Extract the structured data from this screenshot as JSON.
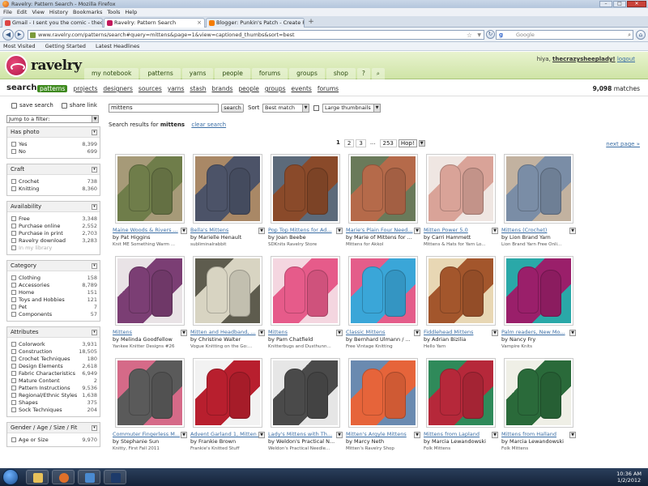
{
  "browser": {
    "window_title": "Ravelry: Pattern Search - Mozilla Firefox",
    "menu": [
      "File",
      "Edit",
      "View",
      "History",
      "Bookmarks",
      "Tools",
      "Help"
    ],
    "tabs": [
      {
        "label": "Gmail - I sent you the comic - thecraz...",
        "active": false
      },
      {
        "label": "Ravelry: Pattern Search",
        "active": true
      },
      {
        "label": "Blogger: Punkin's Patch - Create Post",
        "active": false
      }
    ],
    "url": "www.ravelry.com/patterns/search#query=mittens&page=1&view=captioned_thumbs&sort=best",
    "search_placeholder": "Google",
    "bookmarks": [
      "Most Visited",
      "Getting Started",
      "Latest Headlines"
    ]
  },
  "site": {
    "logo_text": "ravelry",
    "nav": [
      "my notebook",
      "patterns",
      "yarns",
      "people",
      "forums",
      "groups",
      "shop"
    ],
    "greeting": "hiya,",
    "username": "thecrazysheeplady!",
    "logout": "logout"
  },
  "subnav": {
    "title": "search",
    "links": [
      "patterns",
      "projects",
      "designers",
      "sources",
      "yarns",
      "stash",
      "brands",
      "people",
      "groups",
      "events",
      "forums"
    ],
    "selected": "patterns",
    "matches_count": "9,098",
    "matches_label": "matches"
  },
  "sidebar": {
    "save_search": "save search",
    "share_link": "share link",
    "jump_to_filter": "Jump to a filter:",
    "filters": [
      {
        "title": "Has photo",
        "rows": [
          {
            "label": "Yes",
            "count": "8,399"
          },
          {
            "label": "No",
            "count": "699"
          }
        ]
      },
      {
        "title": "Craft",
        "rows": [
          {
            "label": "Crochet",
            "count": "738"
          },
          {
            "label": "Knitting",
            "count": "8,360"
          }
        ]
      },
      {
        "title": "Availability",
        "rows": [
          {
            "label": "Free",
            "count": "3,348"
          },
          {
            "label": "Purchase online",
            "count": "2,552"
          },
          {
            "label": "Purchase in print",
            "count": "2,703"
          },
          {
            "label": "Ravelry download",
            "count": "3,283"
          },
          {
            "label": "In my library",
            "count": "",
            "dim": true
          }
        ]
      },
      {
        "title": "Category",
        "rows": [
          {
            "label": "Clothing",
            "count": "158"
          },
          {
            "label": "Accessories",
            "count": "8,789"
          },
          {
            "label": "Home",
            "count": "151"
          },
          {
            "label": "Toys and Hobbies",
            "count": "121"
          },
          {
            "label": "Pet",
            "count": "7"
          },
          {
            "label": "Components",
            "count": "57"
          }
        ]
      },
      {
        "title": "Attributes",
        "rows": [
          {
            "label": "Colorwork",
            "count": "3,931"
          },
          {
            "label": "Construction",
            "count": "18,505"
          },
          {
            "label": "Crochet Techniques",
            "count": "180"
          },
          {
            "label": "Design Elements",
            "count": "2,618"
          },
          {
            "label": "Fabric Characteristics",
            "count": "6,949"
          },
          {
            "label": "Mature Content",
            "count": "2"
          },
          {
            "label": "Pattern Instructions",
            "count": "9,536"
          },
          {
            "label": "Regional/Ethnic Styles",
            "count": "1,638"
          },
          {
            "label": "Shapes",
            "count": "375"
          },
          {
            "label": "Sock Techniques",
            "count": "204"
          }
        ]
      },
      {
        "title": "Gender / Age / Size / Fit",
        "rows": [
          {
            "label": "Age or Size",
            "count": "9,970"
          }
        ]
      }
    ]
  },
  "main": {
    "query": "mittens",
    "search_button": "search",
    "sort_label": "Sort",
    "sort_value": "Best match",
    "view_value": "Large thumbnails",
    "results_for_prefix": "Search results for",
    "results_for_query": "mittens",
    "clear_search": "clear search",
    "pager": {
      "pages": [
        "1",
        "2",
        "3",
        "...",
        "253"
      ],
      "hop": "Hop!"
    },
    "next_page": "next page »",
    "patterns": [
      {
        "title": "Maine Woods & Rivers ...",
        "by": "by Pat Higgins",
        "source": "Knit ME Something Warm ...",
        "c1": "#6f7d4a",
        "c2": "#a69a78"
      },
      {
        "title": "Bella's Mittens",
        "by": "by Marielle Henault",
        "source": "subliminalrabbit",
        "c1": "#4c5368",
        "c2": "#a98866"
      },
      {
        "title": "Pop Top Mittens for Ad...",
        "by": "by Joan Beebe",
        "source": "SDKnits Ravelry Store",
        "c1": "#8a4a2a",
        "c2": "#5c6a7a"
      },
      {
        "title": "Marie's Plain Four Need...",
        "by": "by Marie of Mittens for ...",
        "source": "Mittens for Akkol",
        "c1": "#b56a4a",
        "c2": "#6a7a5a"
      },
      {
        "title": "Mitten Power 5.0",
        "by": "by Carri Hammett",
        "source": "Mittens & Hats for Yarn Lo...",
        "c1": "#d9a398",
        "c2": "#efe6e2"
      },
      {
        "title": "Mittens (Crochet)",
        "by": "by Lion Brand Yarn",
        "source": "Lion Brand Yarn Free Onli...",
        "c1": "#7a8da6",
        "c2": "#c2b2a0"
      },
      {
        "title": "Mittens",
        "by": "by Melinda Goodfellow",
        "source": "Yankee Knitter Designs #26",
        "c1": "#7b3e74",
        "c2": "#e9e3e6"
      },
      {
        "title": "Mitten and Headband, ...",
        "by": "by Christine Walter",
        "source": "Vogue Knitting on the Go:...",
        "c1": "#d8d4c2",
        "c2": "#5e5c4e"
      },
      {
        "title": "Mittens",
        "by": "by Pam Chatfield",
        "source": "Knitterbugs and Dusthunn...",
        "c1": "#e65b8a",
        "c2": "#f4d6e0"
      },
      {
        "title": "Classic Mittens",
        "by": "by Bernhard Ulmann / ...",
        "source": "Free Vintage Knitting",
        "c1": "#3aa6d8",
        "c2": "#e45d8a"
      },
      {
        "title": "Fiddlehead Mittens",
        "by": "by Adrian Bizilia",
        "source": "Hello Yarn",
        "c1": "#a3562c",
        "c2": "#e8d7b4"
      },
      {
        "title": "Palm readers, New Mo...",
        "by": "by Nancy Fry",
        "source": "Vampire Knits",
        "c1": "#9a1f6a",
        "c2": "#2aa8a8"
      },
      {
        "title": "Commuter Fingerless M...",
        "by": "by Stephanie Sun",
        "source": "Knitty, First Fall 2011",
        "c1": "#5a5a5a",
        "c2": "#d56a88"
      },
      {
        "title": "Advent Garland 1, Mitten ...",
        "by": "by Frankie Brown",
        "source": "Frankie's Knitted Stuff",
        "c1": "#b81f2e",
        "c2": "#f2f2f2"
      },
      {
        "title": "Lady's Mittens with Th...",
        "by": "by Weldon's Practical N...",
        "source": "Weldon's Practical Needle...",
        "c1": "#4a4a4a",
        "c2": "#e6e6e6"
      },
      {
        "title": "Mitten's Argyle Mittens",
        "by": "by Marcy Neth",
        "source": "Mitten's Ravelry Shop",
        "c1": "#e6643a",
        "c2": "#6a8ab0"
      },
      {
        "title": "Mittens from Lapland",
        "by": "by Marcia Lewandowski",
        "source": "Folk Mittens",
        "c1": "#b6283a",
        "c2": "#2f8a5a"
      },
      {
        "title": "Mittens from Halland",
        "by": "by Marcia Lewandowski",
        "source": "Folk Mittens",
        "c1": "#2a6a3a",
        "c2": "#efefe6"
      }
    ]
  },
  "taskbar": {
    "time": "10:36 AM",
    "date": "1/2/2012"
  },
  "colors": {
    "header_green": "#cfe4a6",
    "link_blue": "#3b6ea5",
    "selected_tab": "#3f8a1f"
  }
}
